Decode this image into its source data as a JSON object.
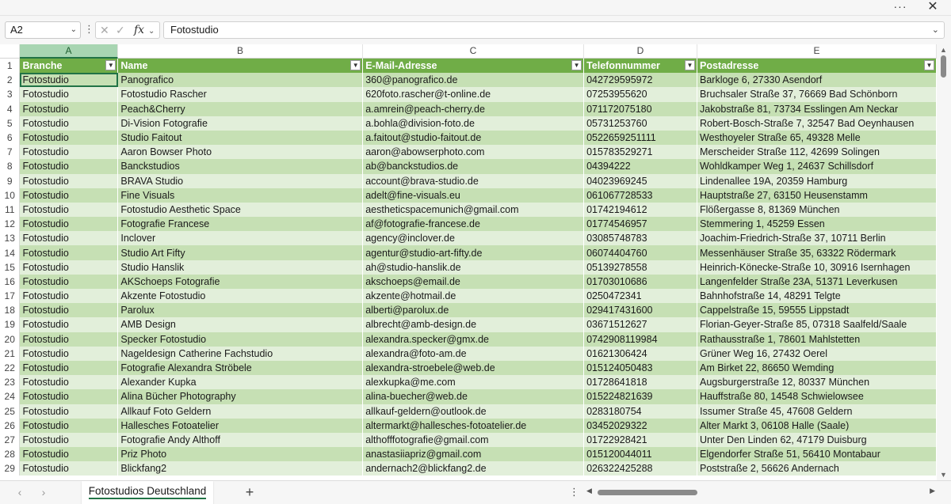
{
  "window": {
    "more_icon": "···",
    "close_icon": "✕"
  },
  "formula_bar": {
    "name_box": "A2",
    "formula": "Fotostudio"
  },
  "columns": [
    "A",
    "B",
    "C",
    "D",
    "E"
  ],
  "header_row": {
    "row_number": "1",
    "cells": [
      "Branche",
      "Name",
      "E-Mail-Adresse",
      "Telefonnummer",
      "Postadresse"
    ]
  },
  "rows": [
    {
      "n": "2",
      "cells": [
        "Fotostudio",
        "Panografico",
        "360@panografico.de",
        "042729595972",
        "Barkloge 6, 27330 Asendorf"
      ]
    },
    {
      "n": "3",
      "cells": [
        "Fotostudio",
        "Fotostudio Rascher",
        "620foto.rascher@t-online.de",
        "07253955620",
        "Bruchsaler Straße 37, 76669 Bad Schönborn"
      ]
    },
    {
      "n": "4",
      "cells": [
        "Fotostudio",
        "Peach&Cherry",
        "a.amrein@peach-cherry.de",
        "071172075180",
        "Jakobstraße 81, 73734 Esslingen Am Neckar"
      ]
    },
    {
      "n": "5",
      "cells": [
        "Fotostudio",
        "Di-Vision Fotografie",
        "a.bohla@division-foto.de",
        "05731253760",
        "Robert-Bosch-Straße 7, 32547 Bad Oeynhausen"
      ]
    },
    {
      "n": "6",
      "cells": [
        "Fotostudio",
        "Studio Faitout",
        "a.faitout@studio-faitout.de",
        "0522659251111",
        "Westhoyeler Straße 65, 49328 Melle"
      ]
    },
    {
      "n": "7",
      "cells": [
        "Fotostudio",
        "Aaron Bowser Photo",
        "aaron@abowserphoto.com",
        "015783529271",
        "Merscheider Straße 112, 42699 Solingen"
      ]
    },
    {
      "n": "8",
      "cells": [
        "Fotostudio",
        "Banckstudios",
        "ab@banckstudios.de",
        "04394222",
        "Wohldkamper Weg 1, 24637 Schillsdorf"
      ]
    },
    {
      "n": "9",
      "cells": [
        "Fotostudio",
        "BRAVA Studio",
        "account@brava-studio.de",
        "04023969245",
        "Lindenallee 19A, 20359 Hamburg"
      ]
    },
    {
      "n": "10",
      "cells": [
        "Fotostudio",
        "Fine Visuals",
        "adelt@fine-visuals.eu",
        "061067728533",
        "Hauptstraße 27, 63150 Heusenstamm"
      ]
    },
    {
      "n": "11",
      "cells": [
        "Fotostudio",
        "Fotostudio Aesthetic Space",
        "aestheticspacemunich@gmail.com",
        "01742194612",
        "Flößergasse 8, 81369 München"
      ]
    },
    {
      "n": "12",
      "cells": [
        "Fotostudio",
        "Fotografie Francese",
        "af@fotografie-francese.de",
        "01774546957",
        "Stemmering 1, 45259 Essen"
      ]
    },
    {
      "n": "13",
      "cells": [
        "Fotostudio",
        "Inclover",
        "agency@inclover.de",
        "03085748783",
        "Joachim-Friedrich-Straße 37, 10711 Berlin"
      ]
    },
    {
      "n": "14",
      "cells": [
        "Fotostudio",
        "Studio Art Fifty",
        "agentur@studio-art-fifty.de",
        "06074404760",
        "Messenhäuser Straße 35, 63322 Rödermark"
      ]
    },
    {
      "n": "15",
      "cells": [
        "Fotostudio",
        "Studio Hanslik",
        "ah@studio-hanslik.de",
        "05139278558",
        "Heinrich-Könecke-Straße 10, 30916 Isernhagen"
      ]
    },
    {
      "n": "16",
      "cells": [
        "Fotostudio",
        "AKSchoeps Fotografie",
        "akschoeps@email.de",
        "01703010686",
        "Langenfelder Straße 23A, 51371 Leverkusen"
      ]
    },
    {
      "n": "17",
      "cells": [
        "Fotostudio",
        "Akzente Fotostudio",
        "akzente@hotmail.de",
        "0250472341",
        "Bahnhofstraße 14, 48291 Telgte"
      ]
    },
    {
      "n": "18",
      "cells": [
        "Fotostudio",
        "Parolux",
        "alberti@parolux.de",
        "029417431600",
        "Cappelstraße 15, 59555 Lippstadt"
      ]
    },
    {
      "n": "19",
      "cells": [
        "Fotostudio",
        "AMB Design",
        "albrecht@amb-design.de",
        "03671512627",
        "Florian-Geyer-Straße 85, 07318 Saalfeld/Saale"
      ]
    },
    {
      "n": "20",
      "cells": [
        "Fotostudio",
        "Specker Fotostudio",
        "alexandra.specker@gmx.de",
        "0742908119984",
        "Rathausstraße 1, 78601 Mahlstetten"
      ]
    },
    {
      "n": "21",
      "cells": [
        "Fotostudio",
        "Nageldesign Catherine Fachstudio",
        "alexandra@foto-am.de",
        "01621306424",
        "Grüner Weg 16, 27432 Oerel"
      ]
    },
    {
      "n": "22",
      "cells": [
        "Fotostudio",
        "Fotografie Alexandra Ströbele",
        "alexandra-stroebele@web.de",
        "015124050483",
        "Am Birket 22, 86650 Wemding"
      ]
    },
    {
      "n": "23",
      "cells": [
        "Fotostudio",
        "Alexander Kupka",
        "alexkupka@me.com",
        "01728641818",
        "Augsburgerstraße 12, 80337 München"
      ]
    },
    {
      "n": "24",
      "cells": [
        "Fotostudio",
        "Alina Bücher Photography",
        "alina-buecher@web.de",
        "015224821639",
        "Hauffstraße 80, 14548 Schwielowsee"
      ]
    },
    {
      "n": "25",
      "cells": [
        "Fotostudio",
        "Allkauf Foto Geldern",
        "allkauf-geldern@outlook.de",
        "0283180754",
        "Issumer Straße 45, 47608 Geldern"
      ]
    },
    {
      "n": "26",
      "cells": [
        "Fotostudio",
        "Hallesches Fotoatelier",
        "altermarkt@hallesches-fotoatelier.de",
        "03452029322",
        "Alter Markt 3, 06108 Halle (Saale)"
      ]
    },
    {
      "n": "27",
      "cells": [
        "Fotostudio",
        "Fotografie Andy Althoff",
        "althofffotografie@gmail.com",
        "01722928421",
        "Unter Den Linden 62, 47179 Duisburg"
      ]
    },
    {
      "n": "28",
      "cells": [
        "Fotostudio",
        "Priz Photo",
        "anastasiiapriz@gmail.com",
        "015120044011",
        "Elgendorfer Straße 51, 56410 Montabaur"
      ]
    },
    {
      "n": "29",
      "cells": [
        "Fotostudio",
        "Blickfang2",
        "andernach2@blickfang2.de",
        "026322425288",
        "Poststraße 2, 56626 Andernach"
      ]
    }
  ],
  "sheet_tabs": {
    "active": "Fotostudios Deutschland",
    "add_label": "+"
  },
  "colors": {
    "header_green": "#70ad47",
    "band_dark": "#c6e0b4",
    "band_light": "#e2efda",
    "selection": "#217346"
  }
}
